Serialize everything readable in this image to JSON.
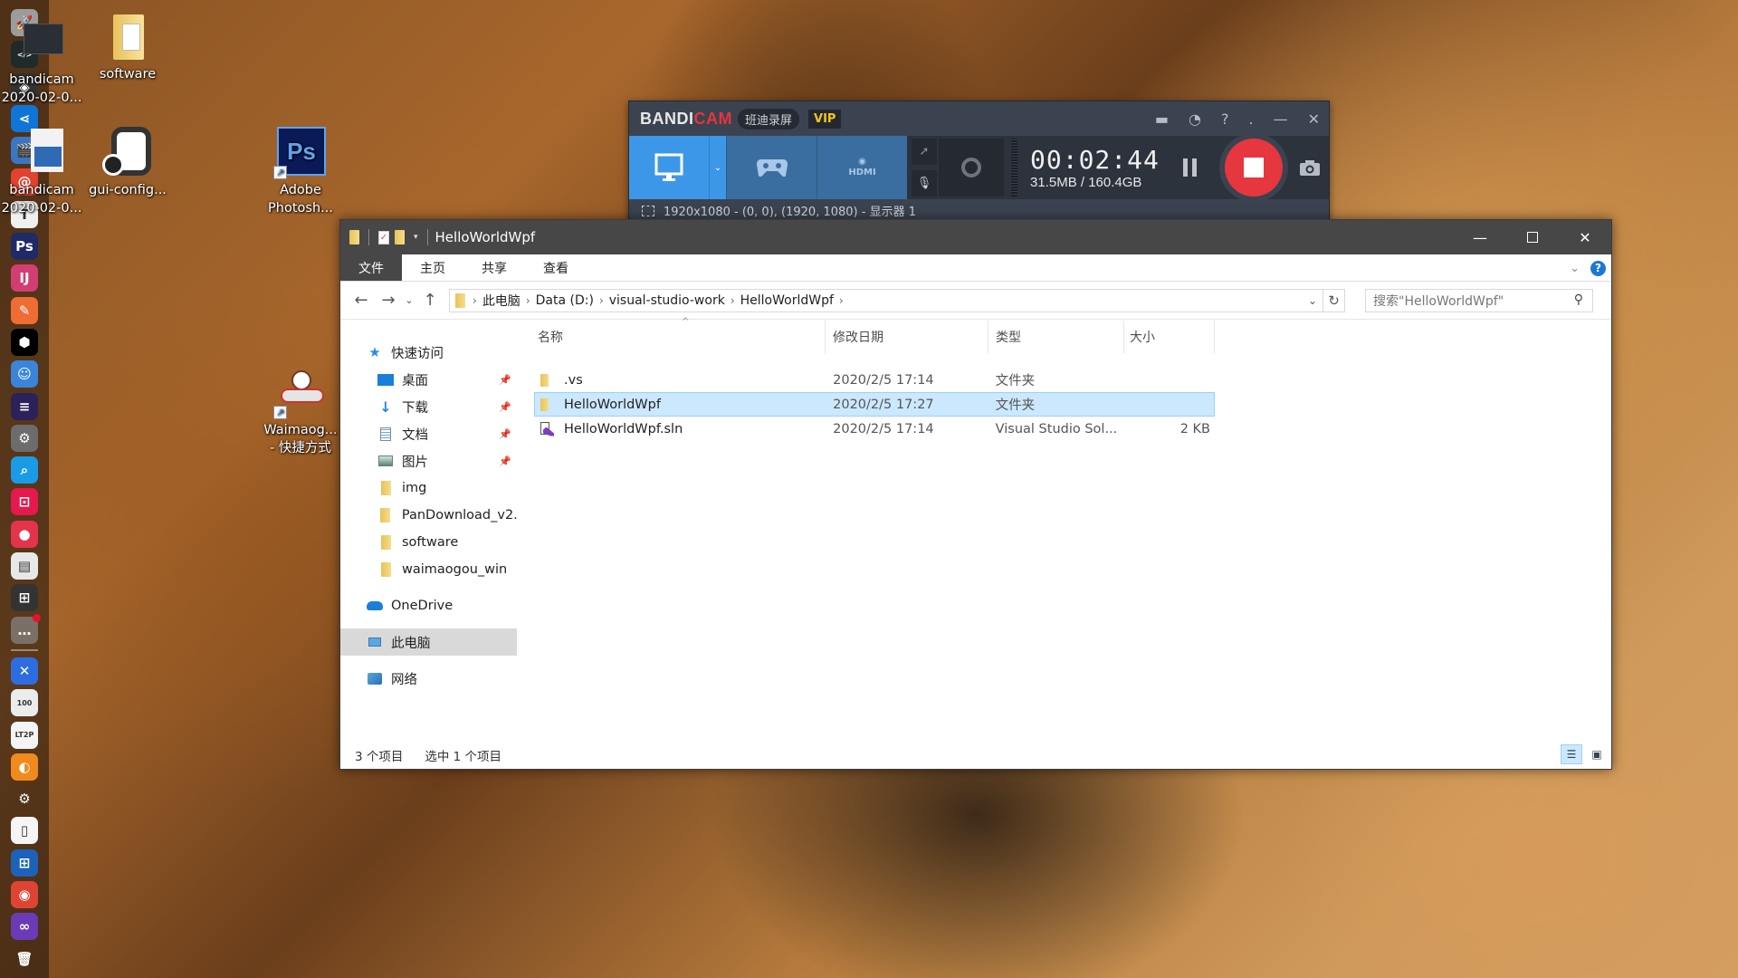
{
  "dock": {
    "items": [
      {
        "name": "launchpad",
        "glyph": "🚀",
        "bg": "#9c9c9c"
      },
      {
        "name": "code-terminal",
        "glyph": "</>",
        "bg": "#1f2a2a"
      },
      {
        "name": "unity",
        "glyph": "◈",
        "bg": "#333"
      },
      {
        "name": "vscode",
        "glyph": "⋖",
        "bg": "#0f75d8"
      },
      {
        "name": "video-editor",
        "glyph": "🎬",
        "bg": "#3b76c4"
      },
      {
        "name": "bandicam-snail",
        "glyph": "@",
        "bg": "#e0432f"
      },
      {
        "name": "typora",
        "glyph": "T",
        "bg": "#f0f0f0"
      },
      {
        "name": "photoshop",
        "glyph": "Ps",
        "bg": "#1f2a66"
      },
      {
        "name": "intellij",
        "glyph": "IJ",
        "bg": "#d23e73"
      },
      {
        "name": "postman",
        "glyph": "✎",
        "bg": "#ef6c35"
      },
      {
        "name": "powershell-hex",
        "glyph": "⬢",
        "bg": "#000"
      },
      {
        "name": "finder",
        "glyph": "☺",
        "bg": "#3a85d9"
      },
      {
        "name": "eclipse",
        "glyph": "≡",
        "bg": "#2c2159"
      },
      {
        "name": "system-prefs",
        "glyph": "⚙",
        "bg": "#6c6c6c"
      },
      {
        "name": "search-tool",
        "glyph": "⌕",
        "bg": "#1a9be8"
      },
      {
        "name": "crop-tool",
        "glyph": "⊡",
        "bg": "#e5194d"
      },
      {
        "name": "screen-recorder",
        "glyph": "●",
        "bg": "#e3344b"
      },
      {
        "name": "notes",
        "glyph": "▤",
        "bg": "#e8e8e8"
      },
      {
        "name": "windows",
        "glyph": "⊞",
        "bg": "#333"
      },
      {
        "name": "more-apps",
        "glyph": "…",
        "bg": "#7a7068"
      },
      {
        "name": "dev-tools",
        "glyph": "✕",
        "bg": "#2e6de0"
      },
      {
        "name": "score-100",
        "glyph": "100",
        "bg": "#ececec"
      },
      {
        "name": "lt2p",
        "glyph": "LT2P",
        "bg": "#f4f4f4"
      },
      {
        "name": "orange-app",
        "glyph": "◐",
        "bg": "#f08a1c"
      },
      {
        "name": "settings",
        "glyph": "⚙",
        "bg": "transparent"
      },
      {
        "name": "blank-file",
        "glyph": "▯",
        "bg": "#f5f5f5"
      },
      {
        "name": "microsoft-store",
        "glyph": "⊞",
        "bg": "#1c62b8"
      },
      {
        "name": "chrome",
        "glyph": "◉",
        "bg": "#dd4433"
      },
      {
        "name": "visual-studio",
        "glyph": "∞",
        "bg": "#6b3bb7"
      },
      {
        "name": "trash",
        "glyph": "🗑",
        "bg": "transparent"
      }
    ]
  },
  "desktop": {
    "icons": [
      {
        "label": "bandicam\n2020-02-0..."
      },
      {
        "label": "software"
      },
      {
        "label": "bandicam\n2020-02-0..."
      },
      {
        "label": "gui-config..."
      },
      {
        "label": "Adobe\nPhotosh..."
      },
      {
        "label": "Waimaog...\n- 快捷方式"
      }
    ]
  },
  "bandicam": {
    "logo_a": "BANDI",
    "logo_b": "CAM",
    "cn_label": "班迪录屏",
    "vip": "VIP",
    "timer": "00:02:44",
    "size": "31.5MB / 160.4GB",
    "status": "1920x1080 - (0, 0), (1920, 1080) - 显示器 1",
    "colors": {
      "accent": "#3d97e8",
      "record": "#e6363e"
    }
  },
  "explorer": {
    "title": "HelloWorldWpf",
    "tabs": [
      "文件",
      "主页",
      "共享",
      "查看"
    ],
    "breadcrumb": [
      "此电脑",
      "Data (D:)",
      "visual-studio-work",
      "HelloWorldWpf"
    ],
    "search_placeholder": "搜索\"HelloWorldWpf\"",
    "nav": {
      "quick_access": "快速访问",
      "pinned": [
        "桌面",
        "下载",
        "文档",
        "图片"
      ],
      "folders": [
        "img",
        "PanDownload_v2.",
        "software",
        "waimaogou_win"
      ],
      "onedrive": "OneDrive",
      "this_pc": "此电脑",
      "network": "网络"
    },
    "columns": [
      "名称",
      "修改日期",
      "类型",
      "大小"
    ],
    "files": [
      {
        "name": ".vs",
        "date": "2020/2/5 17:14",
        "type": "文件夹",
        "size": "",
        "kind": "folder",
        "selected": false
      },
      {
        "name": "HelloWorldWpf",
        "date": "2020/2/5 17:27",
        "type": "文件夹",
        "size": "",
        "kind": "folder",
        "selected": true
      },
      {
        "name": "HelloWorldWpf.sln",
        "date": "2020/2/5 17:14",
        "type": "Visual Studio Sol...",
        "size": "2 KB",
        "kind": "sln",
        "selected": false
      }
    ],
    "status": {
      "count": "3 个项目",
      "selected": "选中 1 个项目"
    }
  }
}
